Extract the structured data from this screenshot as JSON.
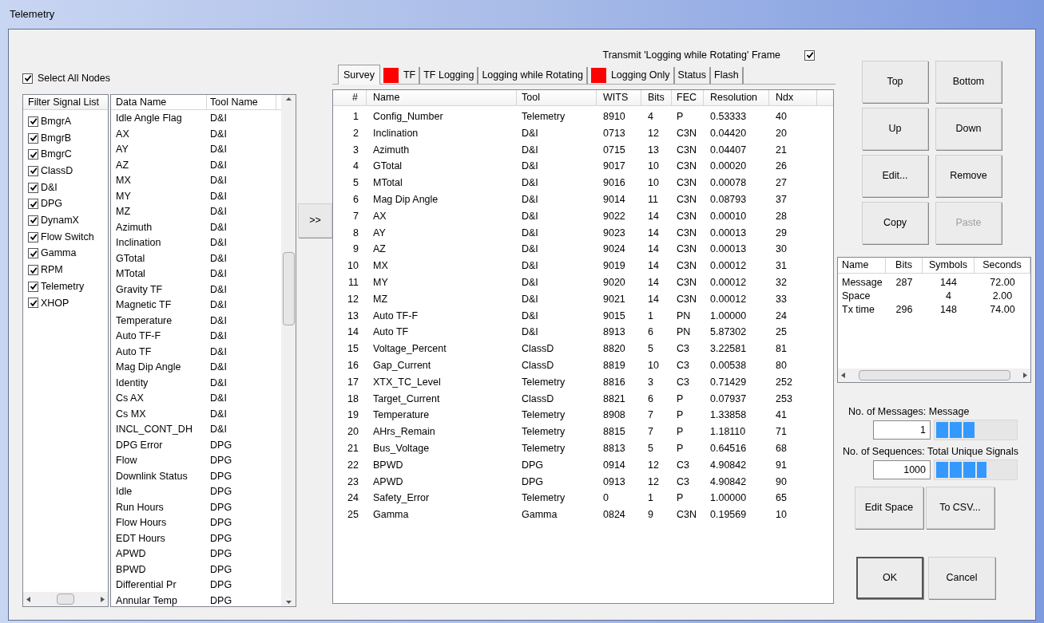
{
  "window": {
    "title": "Telemetry"
  },
  "select_all_nodes": {
    "label": "Select All Nodes",
    "checked": true
  },
  "filter_list": {
    "header": "Filter Signal List",
    "items": [
      {
        "label": "BmgrA",
        "checked": true
      },
      {
        "label": "BmgrB",
        "checked": true
      },
      {
        "label": "BmgrC",
        "checked": true
      },
      {
        "label": "ClassD",
        "checked": true
      },
      {
        "label": "D&I",
        "checked": true
      },
      {
        "label": "DPG",
        "checked": true
      },
      {
        "label": "DynamX",
        "checked": true
      },
      {
        "label": "Flow Switch",
        "checked": true
      },
      {
        "label": "Gamma",
        "checked": true
      },
      {
        "label": "RPM",
        "checked": true
      },
      {
        "label": "Telemetry",
        "checked": true
      },
      {
        "label": "XHOP",
        "checked": true
      }
    ]
  },
  "signal_list": {
    "columns": [
      "Data Name",
      "Tool Name"
    ],
    "rows": [
      [
        "Idle Angle Flag",
        "D&I"
      ],
      [
        "AX",
        "D&I"
      ],
      [
        "AY",
        "D&I"
      ],
      [
        "AZ",
        "D&I"
      ],
      [
        "MX",
        "D&I"
      ],
      [
        "MY",
        "D&I"
      ],
      [
        "MZ",
        "D&I"
      ],
      [
        "Azimuth",
        "D&I"
      ],
      [
        "Inclination",
        "D&I"
      ],
      [
        "GTotal",
        "D&I"
      ],
      [
        "MTotal",
        "D&I"
      ],
      [
        "Gravity TF",
        "D&I"
      ],
      [
        "Magnetic TF",
        "D&I"
      ],
      [
        "Temperature",
        "D&I"
      ],
      [
        "Auto TF-F",
        "D&I"
      ],
      [
        "Auto TF",
        "D&I"
      ],
      [
        "Mag Dip Angle",
        "D&I"
      ],
      [
        "Identity",
        "D&I"
      ],
      [
        "Cs AX",
        "D&I"
      ],
      [
        "Cs MX",
        "D&I"
      ],
      [
        "INCL_CONT_DH",
        "D&I"
      ],
      [
        "DPG Error",
        "DPG"
      ],
      [
        "Flow",
        "DPG"
      ],
      [
        "Downlink Status",
        "DPG"
      ],
      [
        "Idle",
        "DPG"
      ],
      [
        "Run Hours",
        "DPG"
      ],
      [
        "Flow Hours",
        "DPG"
      ],
      [
        "EDT Hours",
        "DPG"
      ],
      [
        "APWD",
        "DPG"
      ],
      [
        "BPWD",
        "DPG"
      ],
      [
        "Differential Pr",
        "DPG"
      ],
      [
        "Annular Temp",
        "DPG"
      ]
    ]
  },
  "add_button": ">>",
  "transmit_lwr": {
    "label": "Transmit 'Logging while Rotating' Frame",
    "checked": true
  },
  "tabs": [
    {
      "label": "Survey",
      "selected": true,
      "flagged": false
    },
    {
      "label": "TF",
      "selected": false,
      "flagged": true
    },
    {
      "label": "TF Logging",
      "selected": false,
      "flagged": false
    },
    {
      "label": "Logging while Rotating",
      "selected": false,
      "flagged": false
    },
    {
      "label": "Logging Only",
      "selected": false,
      "flagged": true
    },
    {
      "label": "Status",
      "selected": false,
      "flagged": false
    },
    {
      "label": "Flash",
      "selected": false,
      "flagged": false
    }
  ],
  "table": {
    "columns": [
      "#",
      "Name",
      "Tool",
      "WITS",
      "Bits",
      "FEC",
      "Resolution",
      "Ndx"
    ],
    "rows": [
      [
        "1",
        "Config_Number",
        "Telemetry",
        "8910",
        "4",
        "P",
        "0.53333",
        "40"
      ],
      [
        "2",
        "Inclination",
        "D&I",
        "0713",
        "12",
        "C3N",
        "0.04420",
        "20"
      ],
      [
        "3",
        "Azimuth",
        "D&I",
        "0715",
        "13",
        "C3N",
        "0.04407",
        "21"
      ],
      [
        "4",
        "GTotal",
        "D&I",
        "9017",
        "10",
        "C3N",
        "0.00020",
        "26"
      ],
      [
        "5",
        "MTotal",
        "D&I",
        "9016",
        "10",
        "C3N",
        "0.00078",
        "27"
      ],
      [
        "6",
        "Mag Dip Angle",
        "D&I",
        "9014",
        "11",
        "C3N",
        "0.08793",
        "37"
      ],
      [
        "7",
        "AX",
        "D&I",
        "9022",
        "14",
        "C3N",
        "0.00010",
        "28"
      ],
      [
        "8",
        "AY",
        "D&I",
        "9023",
        "14",
        "C3N",
        "0.00013",
        "29"
      ],
      [
        "9",
        "AZ",
        "D&I",
        "9024",
        "14",
        "C3N",
        "0.00013",
        "30"
      ],
      [
        "10",
        "MX",
        "D&I",
        "9019",
        "14",
        "C3N",
        "0.00012",
        "31"
      ],
      [
        "11",
        "MY",
        "D&I",
        "9020",
        "14",
        "C3N",
        "0.00012",
        "32"
      ],
      [
        "12",
        "MZ",
        "D&I",
        "9021",
        "14",
        "C3N",
        "0.00012",
        "33"
      ],
      [
        "13",
        "Auto TF-F",
        "D&I",
        "9015",
        "1",
        "PN",
        "1.00000",
        "24"
      ],
      [
        "14",
        "Auto TF",
        "D&I",
        "8913",
        "6",
        "PN",
        "5.87302",
        "25"
      ],
      [
        "15",
        "Voltage_Percent",
        "ClassD",
        "8820",
        "5",
        "C3",
        "3.22581",
        "81"
      ],
      [
        "16",
        "Gap_Current",
        "ClassD",
        "8819",
        "10",
        "C3",
        "0.00538",
        "80"
      ],
      [
        "17",
        "XTX_TC_Level",
        "Telemetry",
        "8816",
        "3",
        "C3",
        "0.71429",
        "252"
      ],
      [
        "18",
        "Target_Current",
        "ClassD",
        "8821",
        "6",
        "P",
        "0.07937",
        "253"
      ],
      [
        "19",
        "Temperature",
        "Telemetry",
        "8908",
        "7",
        "P",
        "1.33858",
        "41"
      ],
      [
        "20",
        "AHrs_Remain",
        "Telemetry",
        "8815",
        "7",
        "P",
        "1.18110",
        "71"
      ],
      [
        "21",
        "Bus_Voltage",
        "Telemetry",
        "8813",
        "5",
        "P",
        "0.64516",
        "68"
      ],
      [
        "22",
        "BPWD",
        "DPG",
        "0914",
        "12",
        "C3",
        "4.90842",
        "91"
      ],
      [
        "23",
        "APWD",
        "DPG",
        "0913",
        "12",
        "C3",
        "4.90842",
        "90"
      ],
      [
        "24",
        "Safety_Error",
        "Telemetry",
        "0",
        "1",
        "P",
        "1.00000",
        "65"
      ],
      [
        "25",
        "Gamma",
        "Gamma",
        "0824",
        "9",
        "C3N",
        "0.19569",
        "10"
      ]
    ]
  },
  "order_buttons": [
    {
      "label": "Top",
      "disabled": false
    },
    {
      "label": "Bottom",
      "disabled": false
    },
    {
      "label": "Up",
      "disabled": false
    },
    {
      "label": "Down",
      "disabled": false
    },
    {
      "label": "Edit...",
      "disabled": false
    },
    {
      "label": "Remove",
      "disabled": false
    },
    {
      "label": "Copy",
      "disabled": false
    },
    {
      "label": "Paste",
      "disabled": true
    }
  ],
  "summary": {
    "columns": [
      "Name",
      "Bits",
      "Symbols",
      "Seconds"
    ],
    "rows": [
      [
        "Message",
        "287",
        "144",
        "72.00"
      ],
      [
        "Space",
        "",
        "4",
        "2.00"
      ],
      [
        "Tx time",
        "296",
        "148",
        "74.00"
      ]
    ]
  },
  "messages": {
    "label": "No. of Messages: Message",
    "value": "1",
    "level": 0.48
  },
  "sequences": {
    "label": "No. of Sequences: Total Unique Signals",
    "value": "1000",
    "level": 0.64
  },
  "action_buttons": [
    "Edit Space",
    "To CSV..."
  ],
  "dialog_buttons": [
    "OK",
    "Cancel"
  ]
}
